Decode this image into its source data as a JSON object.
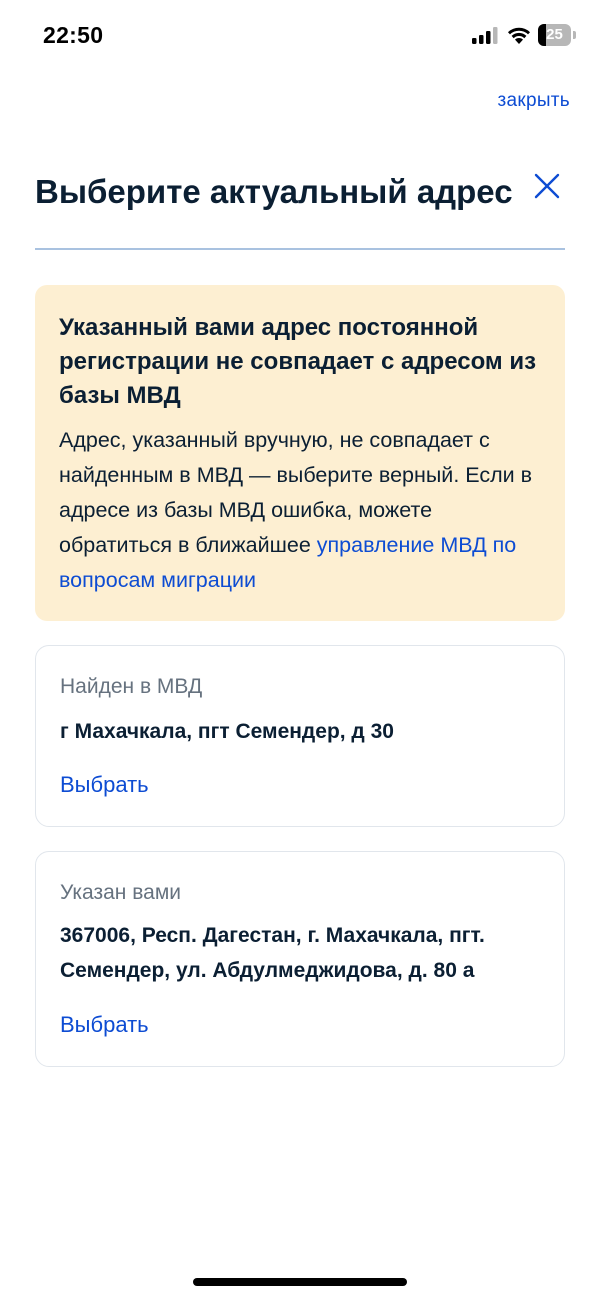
{
  "status_bar": {
    "time": "22:50",
    "battery_level": "25",
    "battery_fraction": 0.25,
    "icons": [
      "signal-icon",
      "wifi-icon",
      "battery-icon"
    ]
  },
  "header": {
    "close_link": "закрыть",
    "title": "Выберите актуальный адрес",
    "close_icon": "close-icon"
  },
  "warning": {
    "title": "Указанный вами адрес постоянной регистрации не совпадает с адресом из базы МВД",
    "text": "Адрес, указанный вручную, не совпадает с найденным в МВД — выберите верный. Если в адресе из базы МВД ошибка, можете обратиться в ближайшее ",
    "link": "управление МВД по вопросам миграции"
  },
  "cards": [
    {
      "label": "Найден в МВД",
      "address": "г Махачкала, пгт Семендер, д 30",
      "action": "Выбрать"
    },
    {
      "label": "Указан вами",
      "address": "367006, Респ. Дагестан, г. Махачкала, пгт. Семендер, ул. Абдулмеджидова, д. 80 а",
      "action": "Выбрать"
    }
  ],
  "colors": {
    "accent": "#0d4cd3",
    "text": "#0b1f33",
    "muted": "#66727f",
    "warning_bg": "#fdefd2",
    "divider": "#a9c2e0"
  }
}
